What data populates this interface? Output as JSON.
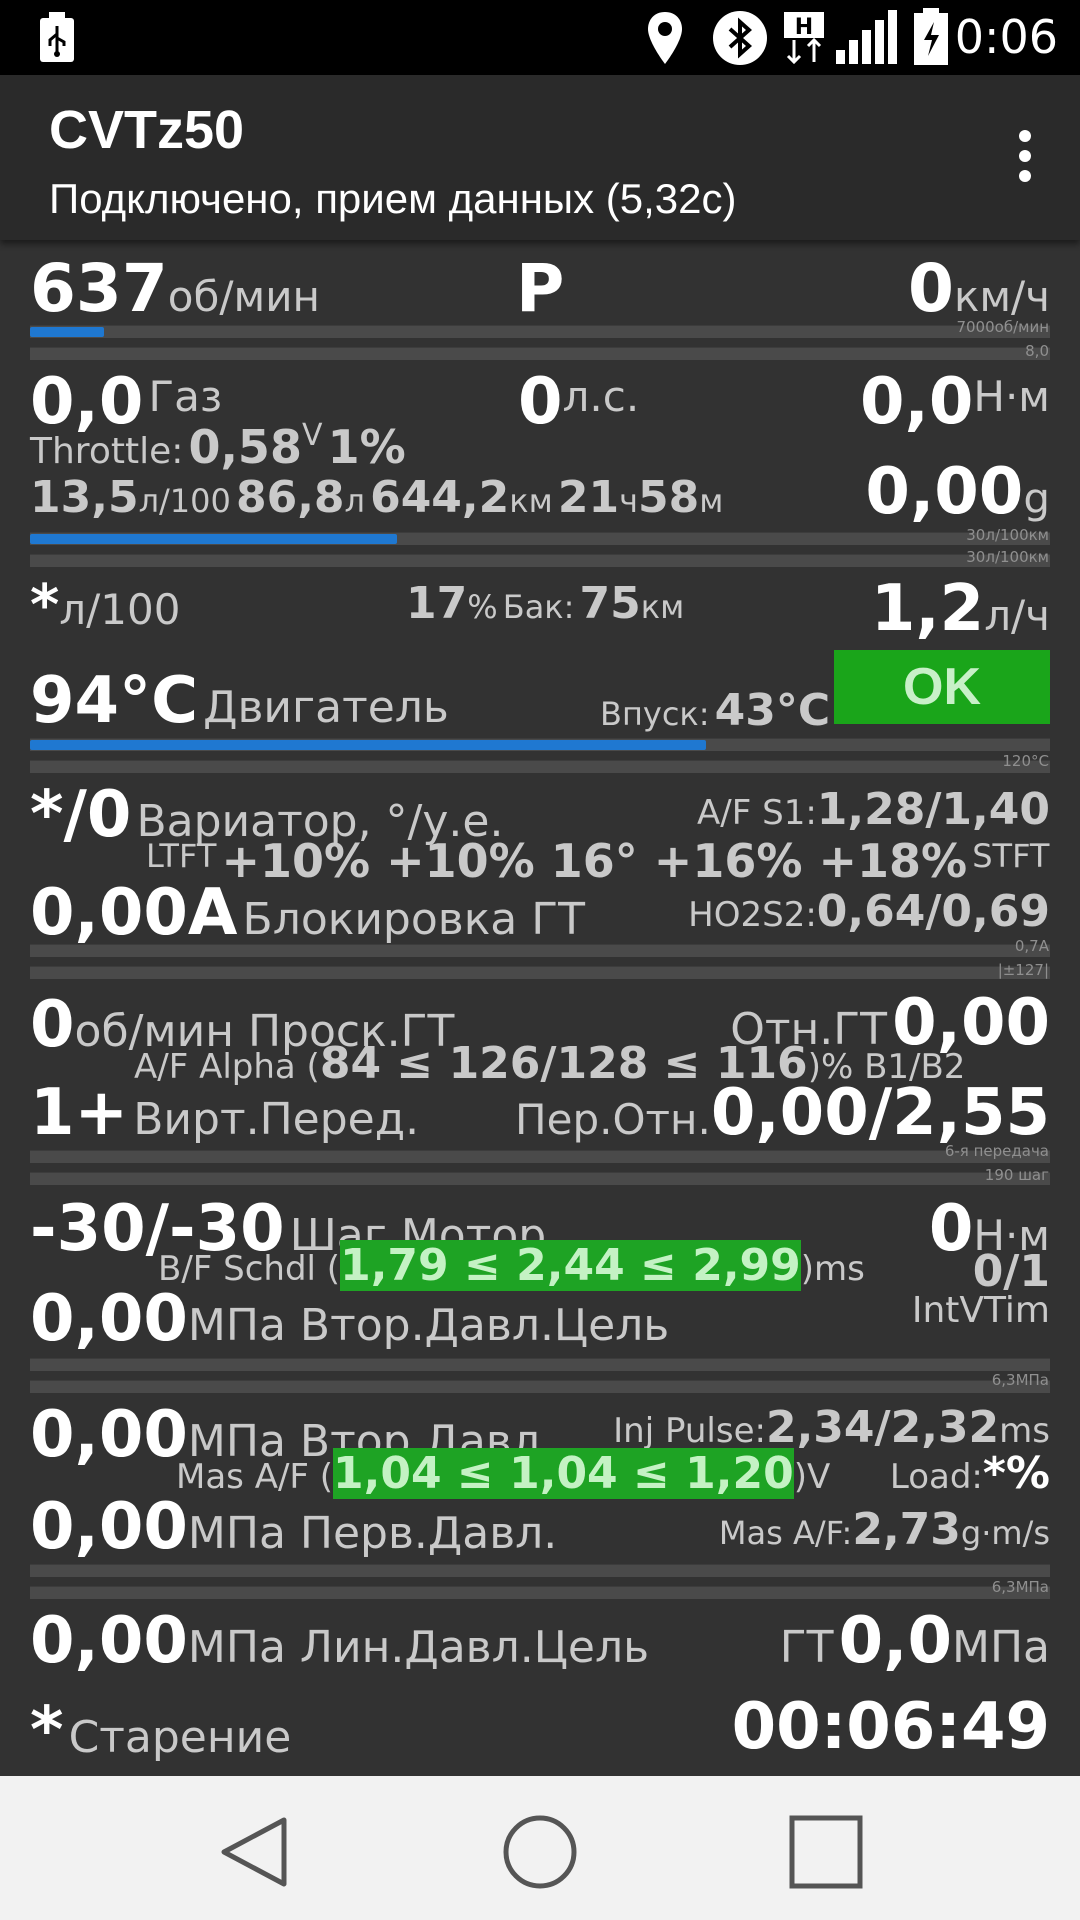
{
  "status": {
    "time": "0:06"
  },
  "app": {
    "title": "CVTz50",
    "subtitle": "Подключено, прием данных (5,32с)"
  },
  "row1": {
    "rpm": "637",
    "rpm_unit": "об/мин",
    "gear": "P",
    "speed": "0",
    "speed_unit": "км/ч",
    "scale_a": "7000об/мин",
    "scale_b": "8,0",
    "rpm_fraction": 0.073
  },
  "row2": {
    "gas": "0,0",
    "gas_label": "Газ",
    "hp": "0",
    "hp_unit": "л.с.",
    "torque": "0,0",
    "torque_unit": "Н·м",
    "throttle_label": "Throttle:",
    "throttle_v": "0,58",
    "throttle_v_unit": "V",
    "throttle_pct": "1%"
  },
  "row3": {
    "cons": "13,5",
    "cons_unit": "л/100",
    "fuel": "86,8",
    "fuel_unit": "л",
    "dist": "644,2",
    "dist_unit": "км",
    "hours": "21",
    "hours_unit": "ч",
    "mins": "58",
    "mins_unit": "м",
    "grams": "0,00",
    "grams_unit": "g",
    "scale_a": "30л/100км",
    "scale_b": "30л/100км",
    "cons_fraction": 0.36
  },
  "row4": {
    "inst": "*",
    "inst_unit": "л/100",
    "tank_pct": "17",
    "tank_pct_unit": "%",
    "tank_label": "Бак:",
    "range": "75",
    "range_unit": "км",
    "rate": "1,2",
    "rate_unit": "л/ч"
  },
  "row5": {
    "engine_temp": "94°C",
    "engine_label": "Двигатель",
    "intake_label": "Впуск:",
    "intake_temp": "43°C",
    "ok": "OK",
    "scale": "120°C",
    "temp_fraction": 0.663
  },
  "row6": {
    "cvt": "*/0",
    "cvt_label": "Вариатор, °/у.е.",
    "afs1_label": "A/F S1:",
    "afs1": "1,28/1,40",
    "ltft_label": "LTFT",
    "trims": "+10% +10% 16° +16% +18%",
    "stft_label": "STFT",
    "lockup": "0,00A",
    "lockup_label": "Блокировка ГТ",
    "ho2_label": "HO2S2:",
    "ho2": "0,64/0,69",
    "scale_a": "0,7A",
    "scale_b": "|±127|"
  },
  "row7": {
    "slip": "0",
    "slip_label": "об/мин Проск.ГТ",
    "tc_ratio_label": "Отн.ГТ",
    "tc_ratio": "0,00",
    "alpha_label": "A/F Alpha (",
    "alpha": "84 ≤ 126/128 ≤ 116",
    "alpha_suffix": ")% B1/B2",
    "vgear": "1+",
    "vgear_label": "Вирт.Перед.",
    "gear_ratio_label": "Пер.Отн.",
    "gear_ratio": "0,00/2,55",
    "scale_a": "6-я передача",
    "scale_b": "190 шаг"
  },
  "row8": {
    "step": "-30/-30",
    "step_label": "Шаг.Мотор",
    "step_torque": "0",
    "step_torque_unit": "Н·м",
    "bf_label": "B/F Schdl (",
    "bf": "1,79 ≤ 2,44 ≤ 2,99",
    "bf_suffix": ")ms",
    "ivt_val": "0/1",
    "ivt_label": "IntVTim",
    "sec_target": "0,00",
    "sec_target_label": "МПа Втор.Давл.Цель",
    "scale": "6,3МПа"
  },
  "row9": {
    "sec": "0,00",
    "sec_label": "МПа Втор.Давл.",
    "inj_label": "Inj Pulse:",
    "inj": "2,34/2,32",
    "inj_unit": "ms",
    "maf_label": "Mas A/F (",
    "maf": "1,04 ≤ 1,04 ≤ 1,20",
    "maf_suffix": ")V",
    "load_label": "Load:",
    "load": "*%",
    "prim": "0,00",
    "prim_label": "МПа Перв.Давл.",
    "mas_label": "Mas A/F:",
    "mas": "2,73",
    "mas_unit": "g·m/s",
    "scale": "6,3МПа"
  },
  "row10": {
    "line": "0,00",
    "line_label": "МПа Лин.Давл.Цель",
    "tc_label": "ГТ",
    "tc": "0,0",
    "tc_unit": "МПа"
  },
  "row11": {
    "aging": "*",
    "aging_label": "Старение",
    "timer": "00:06:49"
  }
}
